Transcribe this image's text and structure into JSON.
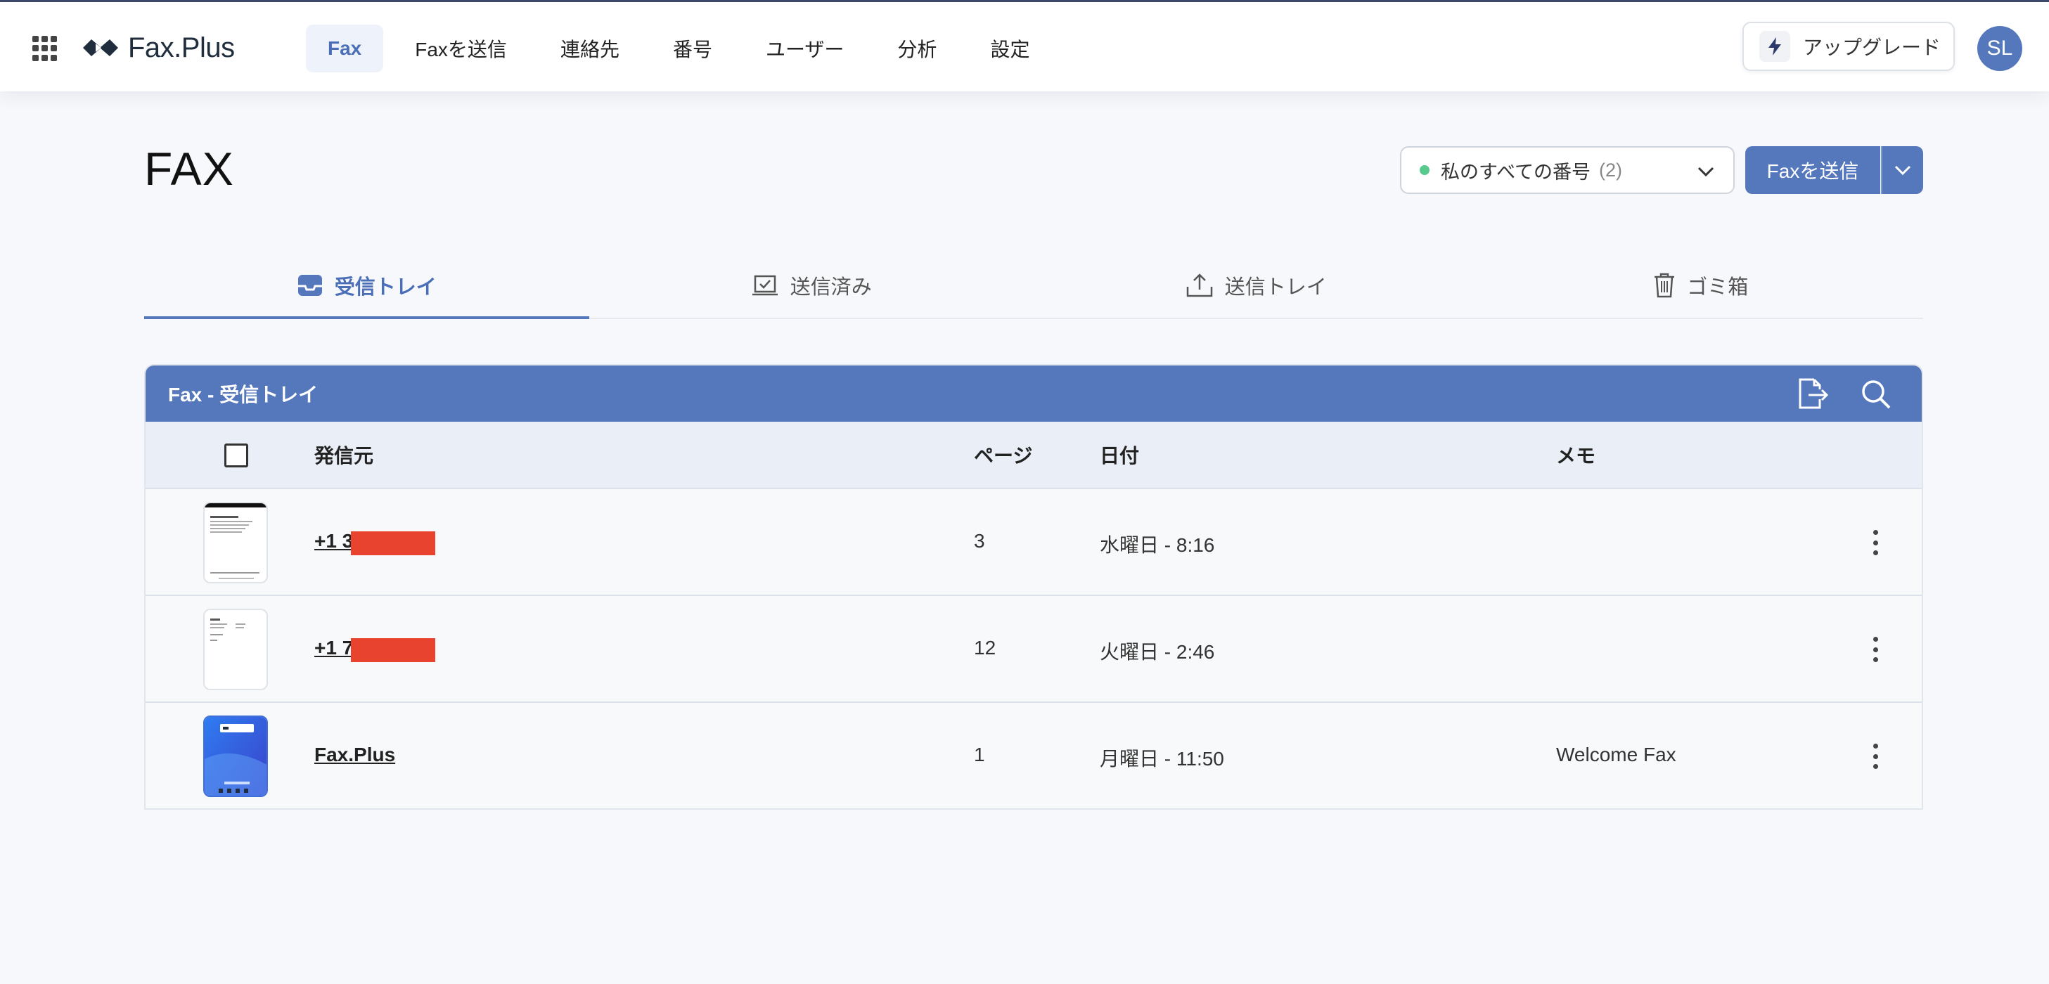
{
  "header": {
    "logo_text": "Fax.Plus",
    "nav": [
      "Fax",
      "Faxを送信",
      "連絡先",
      "番号",
      "ユーザー",
      "分析",
      "設定"
    ],
    "active_nav": 0,
    "upgrade_label": "アップグレード",
    "avatar_initials": "SL"
  },
  "page": {
    "title": "FAX",
    "number_select": {
      "label": "私のすべての番号",
      "count": "(2)"
    },
    "send_button": "Faxを送信"
  },
  "tabs": [
    "受信トレイ",
    "送信済み",
    "送信トレイ",
    "ゴミ箱"
  ],
  "active_tab": 0,
  "table": {
    "title": "Fax - 受信トレイ",
    "columns": {
      "sender": "発信元",
      "pages": "ページ",
      "date": "日付",
      "memo": "メモ"
    },
    "rows": [
      {
        "sender": "+1 3        00",
        "pages": "3",
        "date": "水曜日 - 8:16",
        "memo": "",
        "redacted": true
      },
      {
        "sender": "+1 7        66",
        "pages": "12",
        "date": "火曜日 - 2:46",
        "memo": "",
        "redacted": true
      },
      {
        "sender": "Fax.Plus",
        "pages": "1",
        "date": "月曜日 - 11:50",
        "memo": "Welcome Fax",
        "redacted": false
      }
    ]
  },
  "colors": {
    "primary": "#5577bb",
    "redaction": "#e8432f",
    "online_dot": "#58c98d"
  }
}
